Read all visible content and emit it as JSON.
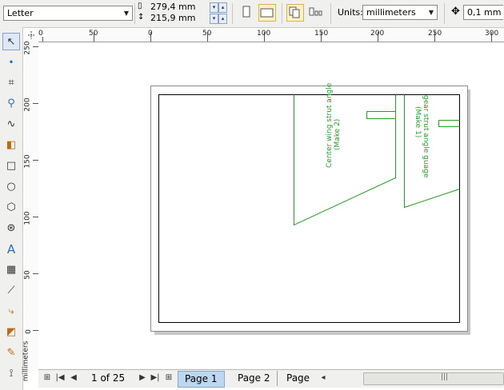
{
  "property_bar": {
    "paper_size": "Letter",
    "width_value": "279,4 mm",
    "height_value": "215,9 mm",
    "units_label": "Units:",
    "units_value": "millimeters",
    "nudge_value": "0,1 mm"
  },
  "toolbox": {
    "tools": [
      "pick-tool",
      "shape-tool",
      "crop-tool",
      "zoom-tool",
      "freehand-tool",
      "smart-fill-tool",
      "rectangle-tool",
      "ellipse-tool",
      "polygon-tool",
      "basic-shapes-tool",
      "text-tool",
      "table-tool",
      "dimension-tool",
      "connector-tool",
      "interactive-blend-tool",
      "eyedropper-tool",
      "outline-pen-tool"
    ]
  },
  "rulers": {
    "horizontal_labels": [
      "0",
      "50",
      "0",
      "50",
      "100",
      "150",
      "200",
      "250",
      "300"
    ],
    "vertical_labels": [
      "250",
      "200",
      "150",
      "100",
      "50",
      "0"
    ],
    "unit_caption": "millimeters"
  },
  "drawing": {
    "text1_line1": "Center wing strut angle",
    "text1_line2": "(Make 2)",
    "text2_line1": "gear strut angle guage",
    "text2_line2": "(Make 1)",
    "stroke_color": "#2a9a2a"
  },
  "page_nav": {
    "page_counter": "1 of 25",
    "tabs": [
      "Page 1",
      "Page 2",
      "Page"
    ]
  }
}
